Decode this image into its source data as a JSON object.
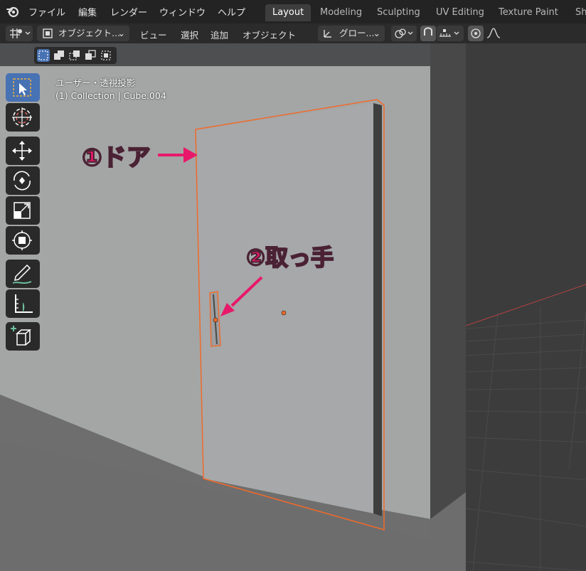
{
  "app": {
    "logo_icon": "blender-logo-icon"
  },
  "topbar": {
    "menus": [
      {
        "label": "ファイル"
      },
      {
        "label": "編集"
      },
      {
        "label": "レンダー"
      },
      {
        "label": "ウィンドウ"
      },
      {
        "label": "ヘルプ"
      }
    ],
    "workspaces": [
      {
        "label": "Layout",
        "active": true
      },
      {
        "label": "Modeling",
        "active": false
      },
      {
        "label": "Sculpting",
        "active": false
      },
      {
        "label": "UV Editing",
        "active": false
      },
      {
        "label": "Texture Paint",
        "active": false
      },
      {
        "label": "Sh",
        "active": false
      }
    ]
  },
  "header": {
    "mode_label": "オブジェクト...",
    "view_menu": "ビュー",
    "select_menu": "選択",
    "add_menu": "追加",
    "object_menu": "オブジェクト",
    "transform_orientation": "グロー...",
    "icons": [
      "editor-type-icon",
      "object-mode-icon",
      "transform-orientation-icon",
      "pivot-icon",
      "snap-magnet-icon",
      "snap-increment-icon",
      "proportional-edit-icon",
      "falloff-curve-icon"
    ]
  },
  "select_modes": [
    "select-new-icon",
    "select-extend-icon",
    "select-subtract-icon",
    "select-invert-icon",
    "select-intersect-icon"
  ],
  "toolbar": {
    "tools": [
      "select-box-icon",
      "cursor-icon",
      "move-icon",
      "rotate-icon",
      "scale-icon",
      "transform-icon",
      "annotate-icon",
      "measure-icon",
      "add-cube-icon"
    ]
  },
  "viewport": {
    "view_name": "ユーザー・透視投影",
    "collection_info": "(1) Collection | Cube.004",
    "colors": {
      "selection_outline": "#f06a2a",
      "annotation": "#e8196a",
      "wall": "#a4a6a6",
      "floor": "#6d6d6d"
    }
  },
  "annotations": {
    "door_label": "①ドア",
    "handle_label": "②取っ手"
  }
}
